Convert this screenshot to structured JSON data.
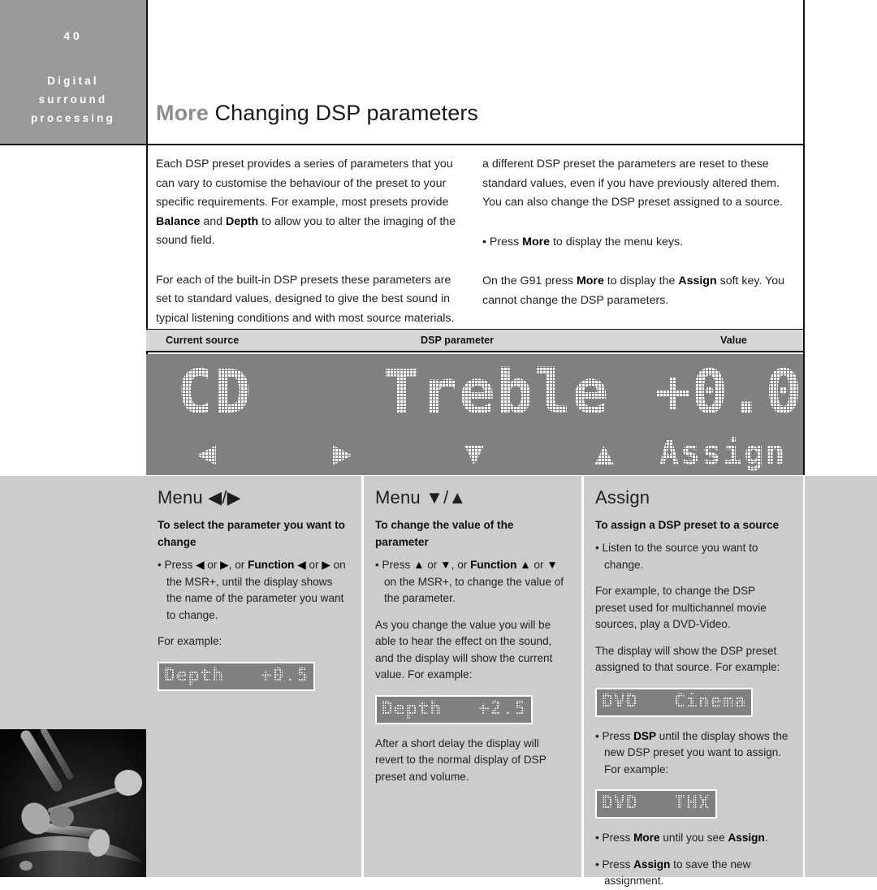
{
  "sidebar": {
    "page_number": "40",
    "section_lines": [
      "Digital",
      "surround",
      "processing"
    ]
  },
  "header": {
    "title_bold": "More",
    "title_rest": " Changing DSP parameters"
  },
  "intro": {
    "left": [
      "Each DSP preset provides a series of parameters that you can vary to customise the behaviour of the preset to your specific requirements. For example, most presets provide <b>Balance</b> and <b>Depth</b> to allow you to alter the imaging of the sound field.",
      "For each of the built-in DSP presets these parameters are set to standard values, designed to give the best sound in typical listening conditions and with most source materials. Each time you select"
    ],
    "right": [
      "a different DSP preset the parameters are reset to these standard values, even if you have previously altered them. You can also change the DSP preset assigned to a source.",
      "• Press <b>More</b> to display the menu keys.",
      "On the G91 press <b>More</b> to display the <b>Assign</b> soft key. You cannot change the DSP parameters."
    ]
  },
  "table_header": {
    "col1": "Current source",
    "col2": "DSP parameter",
    "col3": "Value"
  },
  "lcd": {
    "source": "CD",
    "parameter": "Treble",
    "value": "+0.0",
    "soft_keys": [
      "◀",
      "▶",
      "▼",
      "▲",
      "Assign"
    ]
  },
  "columns": [
    {
      "heading": "Menu ◀/▶",
      "subheading": "To select the parameter you want to change",
      "blocks": [
        {
          "type": "bullet",
          "text": "• Press <b>◀</b> or <b>▶</b>, or <b>Function</b> <b>◀</b> or <b>▶</b> on the MSR+, until the display shows the name of the parameter you want to change."
        },
        {
          "type": "para",
          "text": "For example:"
        },
        {
          "type": "chip",
          "text": "Depth   +0.5"
        }
      ]
    },
    {
      "heading": "Menu ▼/▲",
      "subheading": "To change the value of the parameter",
      "blocks": [
        {
          "type": "bullet",
          "text": "• Press <b>▲</b> or <b>▼</b>, or <b>Function</b> <b>▲</b> or <b>▼</b> on the MSR+, to change the value of the parameter."
        },
        {
          "type": "para",
          "text": "As you change the value you will be able to hear the effect on the sound, and the display will show the current value. For example:"
        },
        {
          "type": "chip",
          "text": "Depth   +2.5"
        },
        {
          "type": "para",
          "text": "After a short delay the display will revert to the normal display of DSP preset and volume."
        }
      ]
    },
    {
      "heading": "Assign",
      "subheading": "To assign a DSP preset to a source",
      "blocks": [
        {
          "type": "bullet",
          "text": "• Listen to the source you want to change."
        },
        {
          "type": "para",
          "text": "For example, to change the DSP preset used for multichannel movie sources, play a DVD-Video."
        },
        {
          "type": "para",
          "text": "The display will show the DSP preset assigned to that source. For example:"
        },
        {
          "type": "chip",
          "text": "DVD   Cinema"
        },
        {
          "type": "bullet",
          "text": "• Press <b>DSP</b> until the display shows the new DSP preset you want to assign. For example:"
        },
        {
          "type": "chip",
          "text": "DVD   THX"
        },
        {
          "type": "bullet",
          "text": "• Press <b>More</b> until you see <b>Assign</b>."
        },
        {
          "type": "bullet",
          "text": "• Press <b>Assign</b> to save the new assignment."
        }
      ]
    }
  ],
  "colors": {
    "sidebar_grey": "#999999",
    "panel_grey": "#cccccc",
    "lcd_grey": "#808080",
    "table_header_grey": "#d6d6d6",
    "title_accent": "#8d8d8d"
  },
  "photo": {
    "alt": "black and white photo of drum mallets striking a cymbal"
  }
}
